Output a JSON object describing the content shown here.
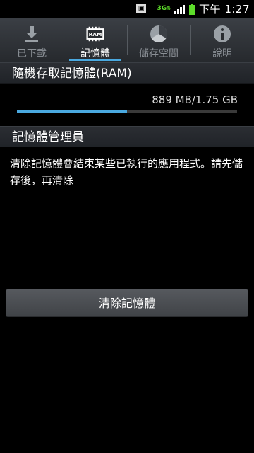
{
  "status_bar": {
    "network": "3G",
    "time": "下午 1:27",
    "icons": [
      "notification-image-icon",
      "3g-data-icon",
      "signal-icon",
      "battery-icon"
    ]
  },
  "tabs": [
    {
      "label": "已下載",
      "icon": "download-icon",
      "active": false
    },
    {
      "label": "記憶體",
      "icon": "ram-icon",
      "icon_text": "RAM",
      "active": true
    },
    {
      "label": "儲存空間",
      "icon": "storage-pie-icon",
      "active": false
    },
    {
      "label": "說明",
      "icon": "info-icon",
      "active": false
    }
  ],
  "ram": {
    "header": "隨機存取記憶體(RAM)",
    "usage_text": "889 MB/1.75 GB",
    "used_fraction": 0.5
  },
  "manager": {
    "header": "記憶體管理員",
    "description": "清除記憶體會結束某些已執行的應用程式。請先儲存後，再清除"
  },
  "clear_button": {
    "label": "清除記憶體"
  },
  "colors": {
    "accent": "#4aa9e0",
    "background": "#000000",
    "network_3g": "#5ddc2a"
  }
}
